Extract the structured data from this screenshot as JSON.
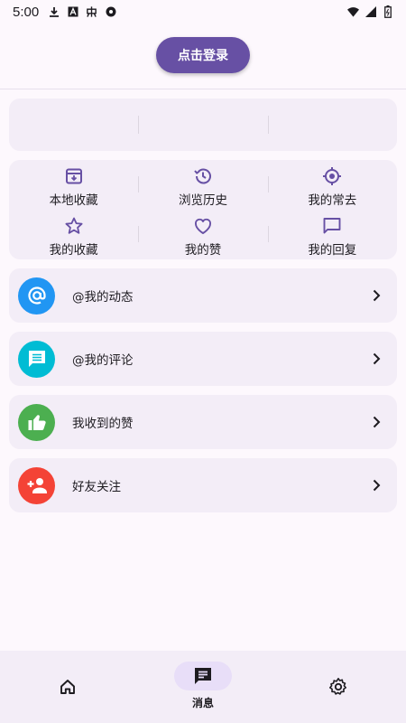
{
  "status_bar": {
    "time": "5:00",
    "left_icons": [
      "download-icon",
      "a-square-icon",
      "notification-app-icon",
      "record-icon"
    ],
    "right_icons": [
      "wifi-icon",
      "signal-icon",
      "battery-icon"
    ]
  },
  "login": {
    "label": "点击登录"
  },
  "quick_actions": {
    "row1": [
      {
        "label": "本地收藏",
        "icon": "archive-icon"
      },
      {
        "label": "浏览历史",
        "icon": "history-icon"
      },
      {
        "label": "我的常去",
        "icon": "location-target-icon"
      }
    ],
    "row2": [
      {
        "label": "我的收藏",
        "icon": "star-outline-icon"
      },
      {
        "label": "我的赞",
        "icon": "heart-outline-icon"
      },
      {
        "label": "我的回复",
        "icon": "chat-bubble-outline-icon"
      }
    ]
  },
  "messages": [
    {
      "label": "@我的动态",
      "icon": "at-sign-icon",
      "color": "#2196f3"
    },
    {
      "label": "@我的评论",
      "icon": "comment-icon",
      "color": "#00bcd4"
    },
    {
      "label": "我收到的赞",
      "icon": "thumb-up-icon",
      "color": "#4caf50"
    },
    {
      "label": "好友关注",
      "icon": "person-add-icon",
      "color": "#f44336"
    }
  ],
  "bottom_nav": {
    "home_icon": "home-icon",
    "messages": {
      "label": "消息",
      "icon": "message-icon",
      "active": true
    },
    "settings_icon": "settings-icon"
  },
  "colors": {
    "primary": "#6750a4",
    "surface": "#f3edf7",
    "background": "#fdf8fd",
    "nav_active": "#e8def8"
  }
}
